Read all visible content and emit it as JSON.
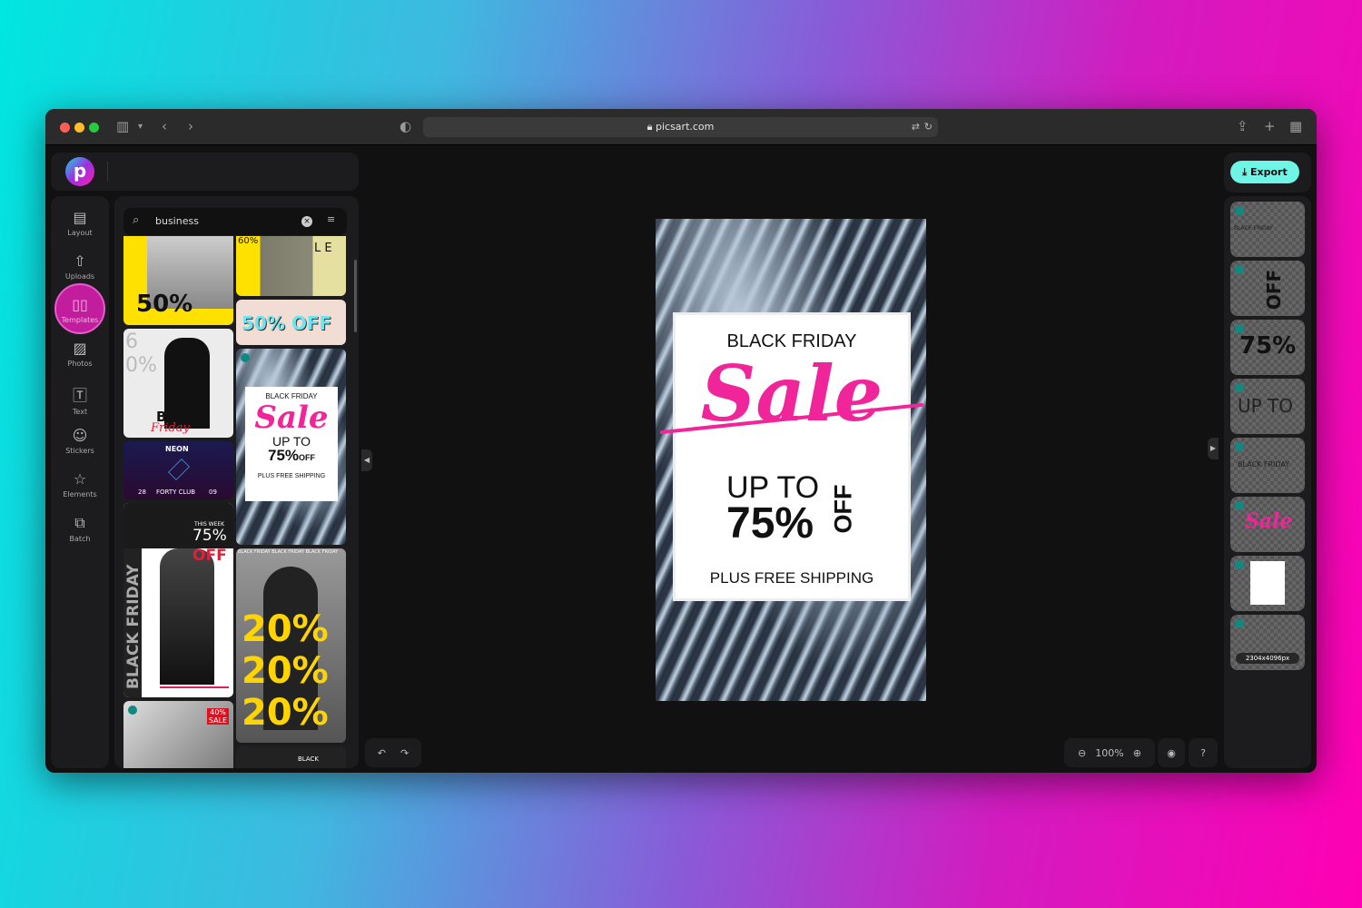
{
  "browser": {
    "url": "picsart.com",
    "colors": {
      "close": "#ff5f57",
      "minimize": "#febc2e",
      "maximize": "#28c840"
    }
  },
  "sidebar": {
    "items": [
      {
        "label": "Layout",
        "icon": "layout-icon"
      },
      {
        "label": "Uploads",
        "icon": "upload-icon"
      },
      {
        "label": "Templates",
        "icon": "book-icon"
      },
      {
        "label": "Photos",
        "icon": "image-icon"
      },
      {
        "label": "Text",
        "icon": "text-icon"
      },
      {
        "label": "Stickers",
        "icon": "sticker-icon"
      },
      {
        "label": "Elements",
        "icon": "star-icon"
      },
      {
        "label": "Batch",
        "icon": "batch-icon"
      }
    ],
    "active": "Templates",
    "accent": "#c21d9c"
  },
  "search": {
    "value": "business"
  },
  "templates": {
    "t1": "50%",
    "t2a": "60%",
    "t2b": "L E",
    "t3": "50% OFF",
    "t4a": "60%",
    "t4b": "BLACK",
    "t4c": "Friday",
    "t5a": "NEON",
    "t5b": "28",
    "t5c": "FORTY CLUB",
    "t5d": "09",
    "t6a": "BLACK FRIDAY",
    "t6b": "Sale",
    "t6c": "UP TO",
    "t6d": "75%",
    "t6e": "OFF",
    "t6f": "PLUS FREE SHIPPING",
    "t7a": "THIS WEEK",
    "t7b": "75%",
    "t7c": "OFF",
    "t7d": "BLACK FRIDAY",
    "t8a": "BLACK FRIDAY BLACK FRIDAY BLACK FRIDAY",
    "t8b": "20%",
    "t9": "40% SALE",
    "t10": "BLACK"
  },
  "canvas": {
    "title": "BLACK FRIDAY",
    "script": "Sale",
    "upto": "UP TO",
    "percent": "75%",
    "off": "OFF",
    "footer": "PLUS FREE SHIPPING",
    "accent": "#f0259a"
  },
  "toolbar": {
    "export_label": "Export",
    "export_color": "#6ef5e6",
    "zoom": "100%"
  },
  "layers": [
    {
      "label": "BLACK FRIDAY"
    },
    {
      "label": "OFF"
    },
    {
      "label": "75%"
    },
    {
      "label": "UP TO"
    },
    {
      "label": "BLACK FRIDAY"
    },
    {
      "label": "Sale"
    },
    {
      "label": ""
    },
    {
      "label": "2304x4096px"
    }
  ]
}
